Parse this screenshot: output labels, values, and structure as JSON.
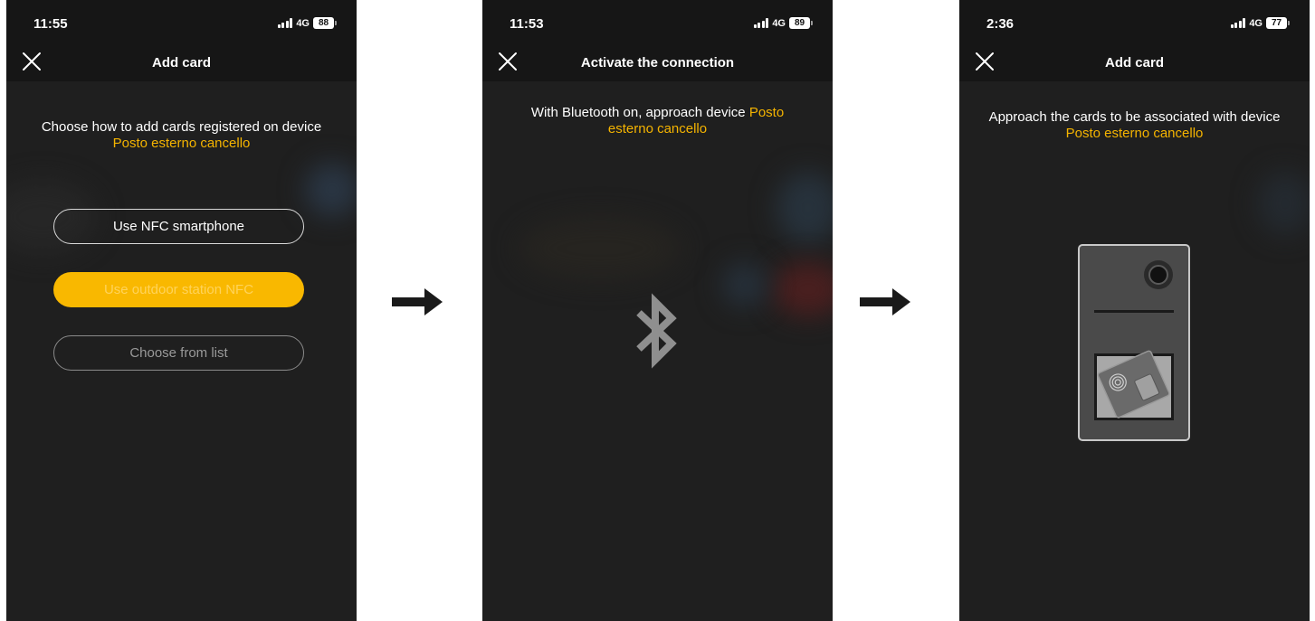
{
  "colors": {
    "accent": "#f5b400",
    "button_fill": "#f9b800",
    "screen_bg": "#1f1f1f"
  },
  "screens": [
    {
      "status": {
        "time": "11:55",
        "network": "4G",
        "battery": "88"
      },
      "title": "Add card",
      "message": "Choose how to add cards registered on device",
      "device_name": "Posto esterno cancello",
      "buttons": [
        "Use NFC smartphone",
        "Use outdoor station NFC",
        "Choose from list"
      ]
    },
    {
      "status": {
        "time": "11:53",
        "network": "4G",
        "battery": "89"
      },
      "title": "Activate the connection",
      "message": "With Bluetooth on, approach device",
      "device_name": "Posto esterno cancello",
      "icon": "bluetooth-icon"
    },
    {
      "status": {
        "time": "2:36",
        "network": "4G",
        "battery": "77"
      },
      "title": "Add card",
      "message": "Approach the cards to be associated with device",
      "device_name": "Posto esterno cancello",
      "illustration": "outdoor-station-with-card"
    }
  ],
  "flow_arrows": [
    "arrow-right-icon",
    "arrow-right-icon"
  ]
}
